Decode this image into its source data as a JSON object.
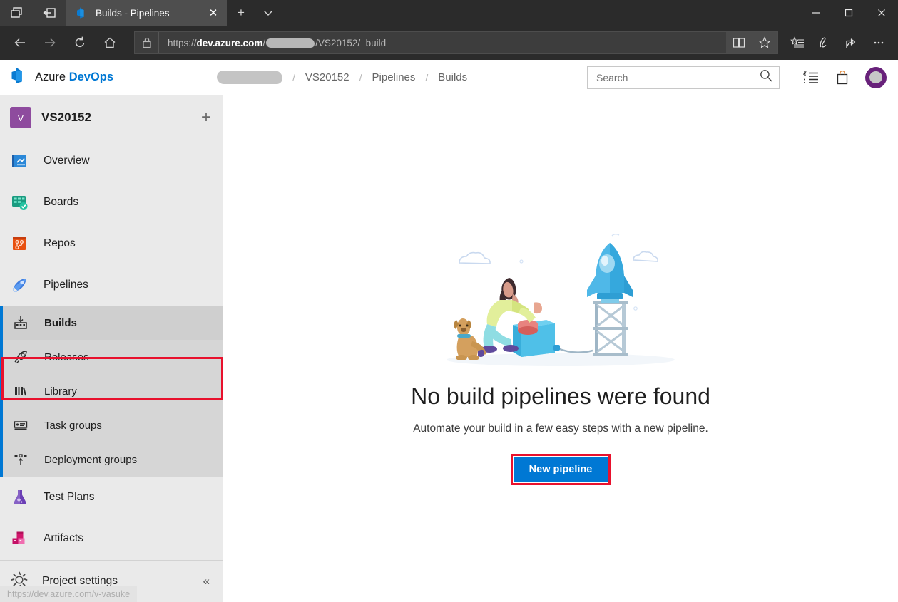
{
  "browser": {
    "tab": {
      "title": "Builds - Pipelines",
      "favicon_icon": "azure-devops-favicon"
    },
    "tab_preview_icon": "tab-preview-icon",
    "set_tabs_aside_icon": "set-tabs-aside-icon",
    "new_tab_label": "+",
    "tab_menu_label": "⌄",
    "nav": {
      "back_label": "←",
      "forward_label": "→",
      "refresh_label": "↻",
      "home_label": "⌂"
    },
    "url": {
      "scheme": "https://",
      "domain": "dev.azure.com",
      "slash": "/",
      "redacted": "",
      "path": "/VS20152/_build",
      "lock_icon": "lock-icon",
      "reading_view_icon": "reading-view-icon",
      "favorite_icon": "star-icon"
    },
    "toolbar": {
      "favorites_hub_icon": "favorites-list-icon",
      "web_notes_icon": "pen-icon",
      "share_icon": "share-icon",
      "settings_icon": "ellipsis-icon"
    },
    "window": {
      "minimize": "—",
      "maximize": "□",
      "close": "✕"
    }
  },
  "header": {
    "logo_text_1": "Azure ",
    "logo_text_2": "DevOps",
    "logo_icon": "azure-devops-logo",
    "breadcrumb": {
      "org_redacted": "",
      "items": [
        {
          "label": "VS20152"
        },
        {
          "label": "Pipelines"
        },
        {
          "label": "Builds"
        }
      ],
      "separator": "/"
    },
    "search": {
      "placeholder": "Search",
      "value": "",
      "icon": "search-icon"
    },
    "icons": [
      {
        "name": "task-list-icon"
      },
      {
        "name": "marketplace-bag-icon"
      }
    ],
    "avatar_name": "user-avatar"
  },
  "sidebar": {
    "project": {
      "initial": "V",
      "name": "VS20152",
      "add_label": "+"
    },
    "items": [
      {
        "label": "Overview",
        "icon": "overview-icon",
        "type": "top"
      },
      {
        "label": "Boards",
        "icon": "boards-icon",
        "type": "top"
      },
      {
        "label": "Repos",
        "icon": "repos-icon",
        "type": "top"
      },
      {
        "label": "Pipelines",
        "icon": "pipelines-icon",
        "type": "top",
        "annotated": true
      },
      {
        "label": "Builds",
        "icon": "builds-icon",
        "type": "sub",
        "selected": true
      },
      {
        "label": "Releases",
        "icon": "releases-icon",
        "type": "sub"
      },
      {
        "label": "Library",
        "icon": "library-icon",
        "type": "sub"
      },
      {
        "label": "Task groups",
        "icon": "task-groups-icon",
        "type": "sub"
      },
      {
        "label": "Deployment groups",
        "icon": "deployment-groups-icon",
        "type": "sub"
      },
      {
        "label": "Test Plans",
        "icon": "test-plans-icon",
        "type": "top"
      },
      {
        "label": "Artifacts",
        "icon": "artifacts-icon",
        "type": "top"
      }
    ],
    "settings": {
      "label": "Project settings",
      "icon": "gear-icon",
      "collapse_label": "«"
    },
    "status_link": "https://dev.azure.com/v-vasuke"
  },
  "main": {
    "illustration_name": "rocket-launch-illustration",
    "title": "No build pipelines were found",
    "subtitle": "Automate your build in a few easy steps with a new pipeline.",
    "primary_button": "New pipeline"
  },
  "colors": {
    "accent_blue": "#0078d4",
    "annotation_red": "#e8112d",
    "sidebar_bg": "#eaeaea",
    "sidebar_sub_bg": "#d6d6d6",
    "browser_chrome": "#2b2b2b",
    "project_avatar": "#8e4b9e",
    "user_avatar": "#68217a"
  }
}
